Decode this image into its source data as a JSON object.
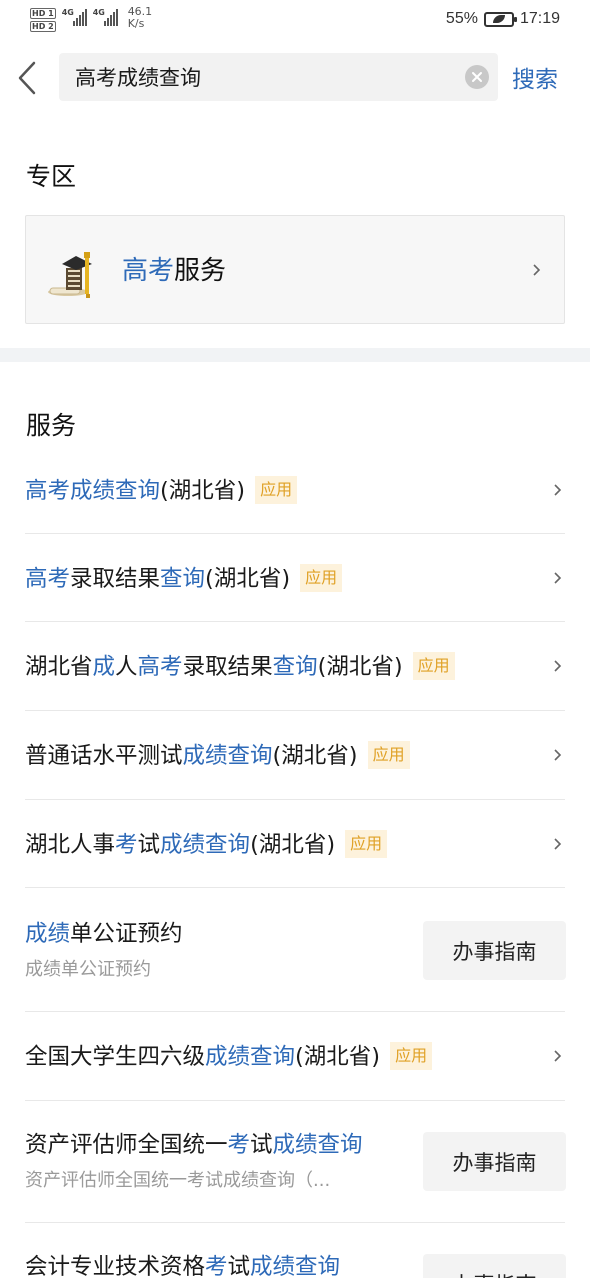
{
  "status_bar": {
    "sim1": "HD 1",
    "sim2": "HD 2",
    "net1": "4G",
    "net2": "4G",
    "speed_value": "46.1",
    "speed_unit": "K/s",
    "battery": "55%",
    "time": "17:19"
  },
  "search": {
    "value": "高考成绩查询",
    "placeholder": "",
    "search_label": "搜索"
  },
  "zone": {
    "title": "专区",
    "card": {
      "label_highlight": "高考",
      "label_rest": "服务",
      "icon": "graduation-books-icon"
    }
  },
  "services": {
    "title": "服务",
    "tag": "应用",
    "guide_label": "办事指南",
    "items": [
      {
        "p1": "高考成绩查询",
        "p2": "(湖北省)"
      },
      {
        "p1": "高考",
        "p2": "录取结果",
        "p3": "查询",
        "p4": "(湖北省)"
      },
      {
        "p1": "湖北省",
        "p2": "成",
        "p3": "人",
        "p4": "高考",
        "p5": "录取结果",
        "p6": "查询",
        "p7": "(湖北省)"
      },
      {
        "p1": "普通话水平测试",
        "p2": "成绩查询",
        "p3": "(湖北省)"
      },
      {
        "p1": "湖北人事",
        "p2": "考",
        "p3": "试",
        "p4": "成绩查询",
        "p5": "(湖北省)"
      },
      {
        "p1": "成绩",
        "p2": "单公证预约",
        "sub": "成绩单公证预约"
      },
      {
        "p1": "全国大学生四六级",
        "p2": "成绩查询",
        "p3": "(湖北省)"
      },
      {
        "p1": "资产评估师全国统一",
        "p2": "考",
        "p3": "试",
        "p4": "成绩查询",
        "sub": "资产评估师全国统一考试成绩查询（..."
      },
      {
        "p1": "会计专业技术资格",
        "p2": "考",
        "p3": "试",
        "p4": "成绩查询"
      }
    ]
  },
  "colors": {
    "accent": "#2e6ab8",
    "tag_text": "#e0a126",
    "tag_bg": "#fdf2dc"
  }
}
